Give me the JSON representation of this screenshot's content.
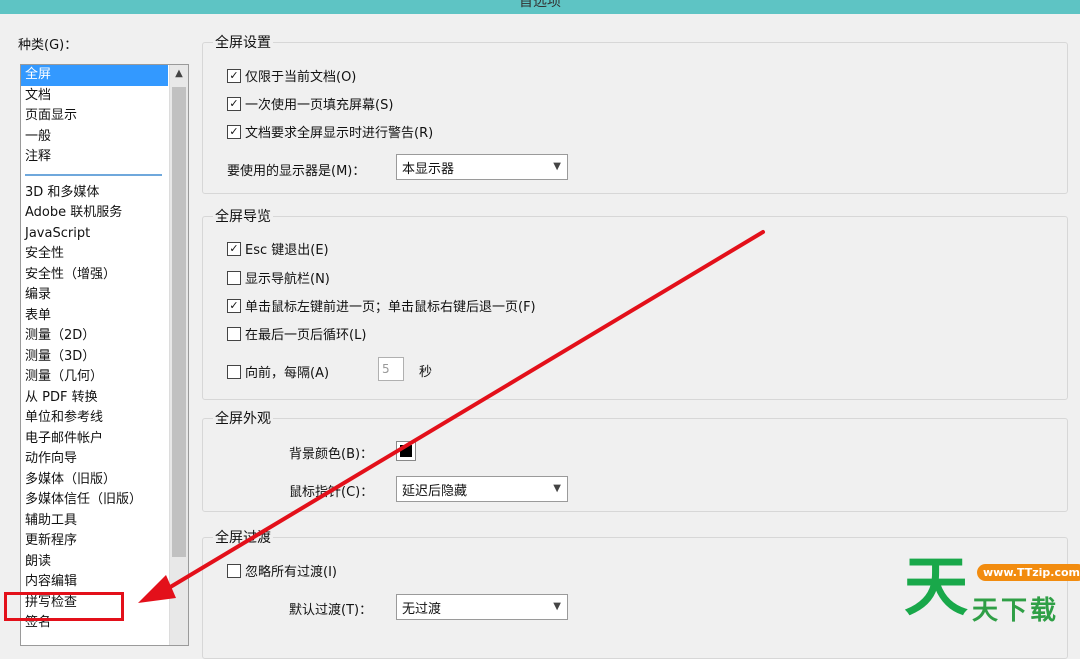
{
  "window": {
    "title": "首选项"
  },
  "categories": {
    "label": "种类(G)：",
    "top_items": [
      "全屏",
      "文档",
      "页面显示",
      "一般",
      "注释"
    ],
    "selected": "全屏",
    "items": [
      "3D 和多媒体",
      "Adobe 联机服务",
      "JavaScript",
      "安全性",
      "安全性（增强）",
      "编录",
      "表单",
      "测量（2D）",
      "测量（3D）",
      "测量（几何）",
      "从 PDF 转换",
      "单位和参考线",
      "电子邮件帐户",
      "动作向导",
      "多媒体（旧版）",
      "多媒体信任（旧版）",
      "辅助工具",
      "更新程序",
      "朗读",
      "内容编辑",
      "拼写检查",
      "签名"
    ]
  },
  "fullscreen_settings": {
    "title": "全屏设置",
    "checkboxes": [
      {
        "label": "仅限于当前文档(O)",
        "checked": true
      },
      {
        "label": "一次使用一页填充屏幕(S)",
        "checked": true
      },
      {
        "label": "文档要求全屏显示时进行警告(R)",
        "checked": true
      }
    ],
    "monitor_label": "要使用的显示器是(M)：",
    "monitor_value": "本显示器"
  },
  "fullscreen_navigation": {
    "title": "全屏导览",
    "checkboxes": [
      {
        "label": "Esc 键退出(E)",
        "checked": true
      },
      {
        "label": "显示导航栏(N)",
        "checked": false
      },
      {
        "label": "单击鼠标左键前进一页；单击鼠标右键后退一页(F)",
        "checked": true
      },
      {
        "label": "在最后一页后循环(L)",
        "checked": false
      }
    ],
    "advance": {
      "label": "向前，每隔(A)",
      "checked": false,
      "value": "5",
      "unit": "秒"
    }
  },
  "fullscreen_appearance": {
    "title": "全屏外观",
    "bg_color_label": "背景颜色(B)：",
    "bg_color": "#000000",
    "pointer_label": "鼠标指针(C)：",
    "pointer_value": "延迟后隐藏"
  },
  "fullscreen_transitions": {
    "title": "全屏过渡",
    "ignore_all": {
      "label": "忽略所有过渡(I)",
      "checked": false
    },
    "default_label": "默认过渡(T)：",
    "default_value": "无过渡"
  },
  "annotation": {
    "color": "#e3101a",
    "target": "拼写检查"
  },
  "watermark": {
    "logo": "天",
    "url": "www.TTzip.com",
    "text": "天下载"
  }
}
